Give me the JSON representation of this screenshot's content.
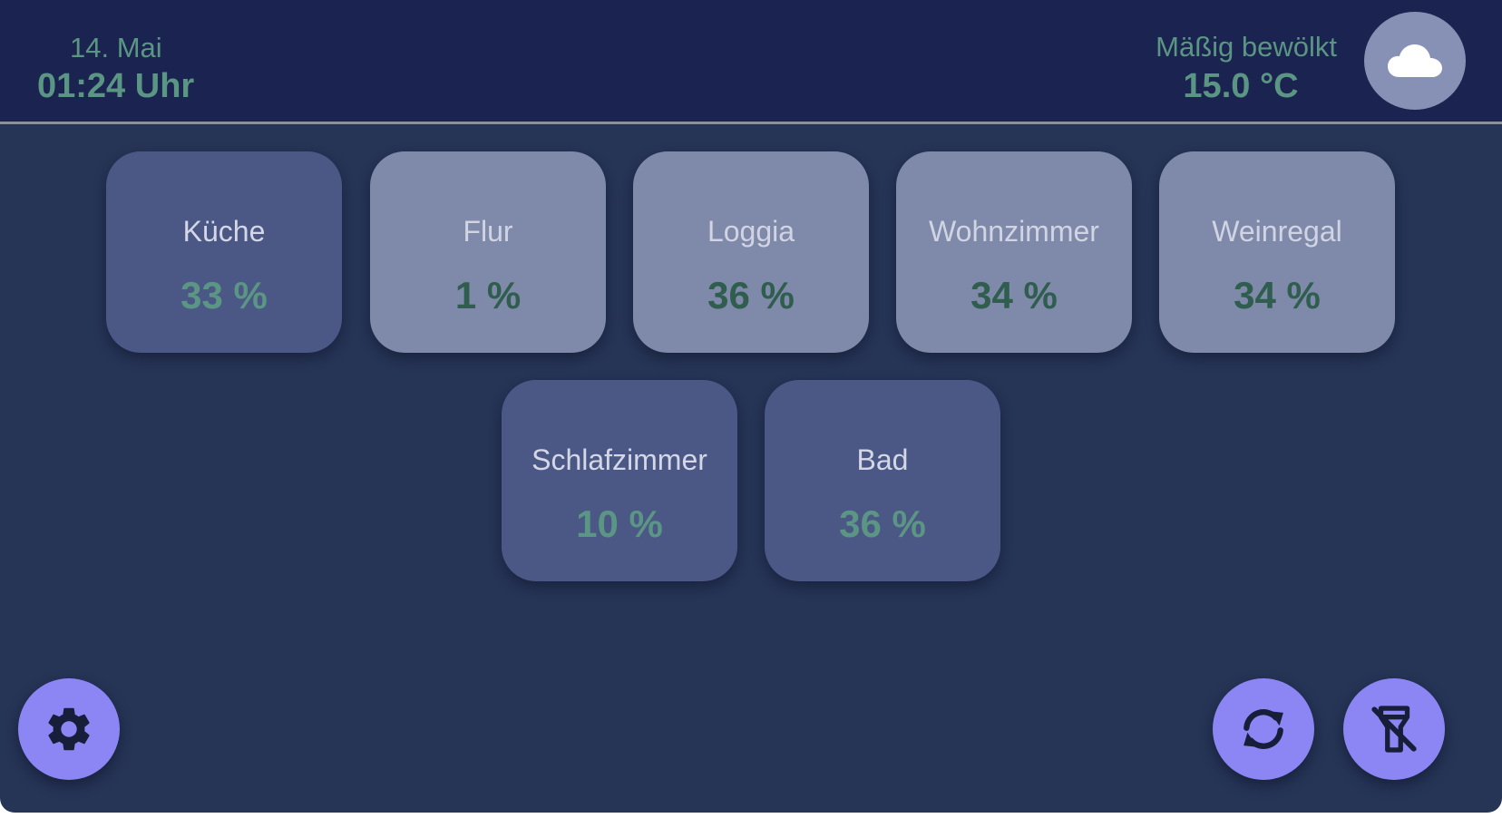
{
  "header": {
    "date": "14. Mai",
    "time": "01:24 Uhr",
    "weather": {
      "description": "Mäßig bewölkt",
      "temperature": "15.0 °C",
      "icon": "cloud-icon"
    }
  },
  "rooms": [
    {
      "name": "Küche",
      "value": "33 %",
      "state": "on"
    },
    {
      "name": "Flur",
      "value": "1 %",
      "state": "off"
    },
    {
      "name": "Loggia",
      "value": "36 %",
      "state": "off"
    },
    {
      "name": "Wohnzimmer",
      "value": "34 %",
      "state": "off"
    },
    {
      "name": "Weinregal",
      "value": "34 %",
      "state": "off"
    },
    {
      "name": "Schlafzimmer",
      "value": "10 %",
      "state": "on"
    },
    {
      "name": "Bad",
      "value": "36 %",
      "state": "on"
    }
  ],
  "actions": {
    "settings_icon": "gear-icon",
    "refresh_icon": "refresh-icon",
    "flash_off_icon": "flashlight-off-icon"
  },
  "colors": {
    "background": "#263456",
    "header": "#1b2450",
    "tile_active": "#4b5886",
    "tile_inactive": "#7f89a9",
    "accent_text": "#5b9583",
    "fab": "#8c86f5"
  }
}
